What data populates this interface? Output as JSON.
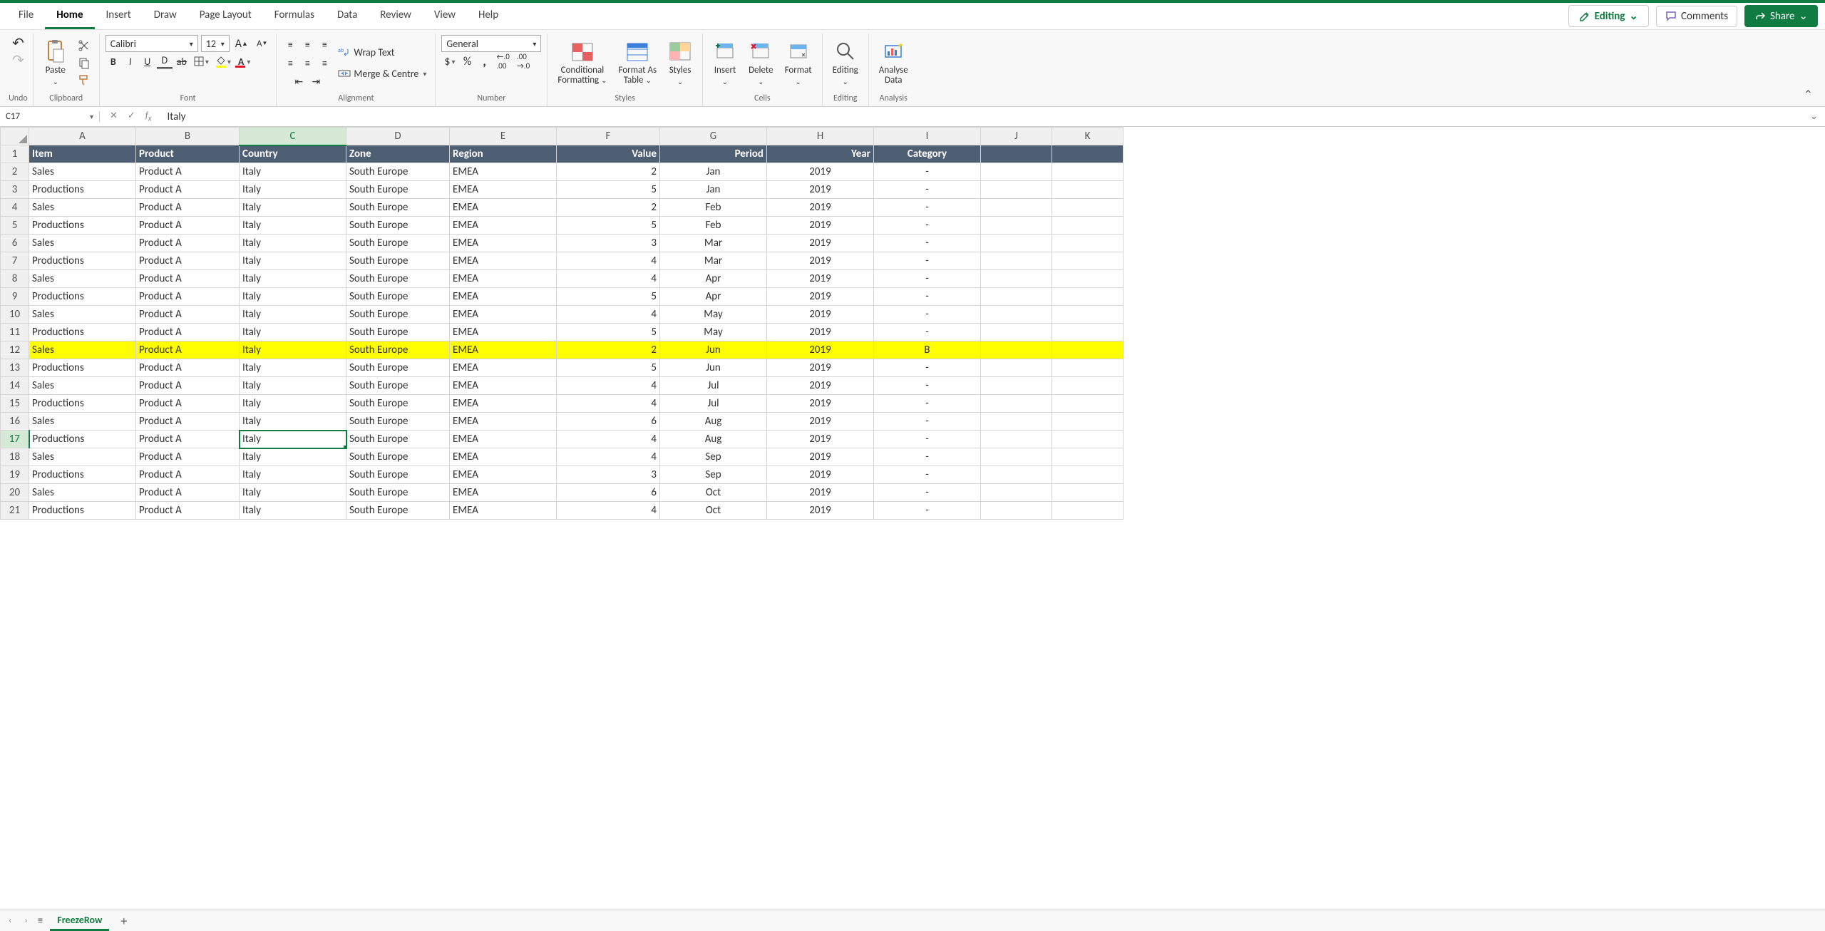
{
  "tabs": [
    "File",
    "Home",
    "Insert",
    "Draw",
    "Page Layout",
    "Formulas",
    "Data",
    "Review",
    "View",
    "Help"
  ],
  "active_tab": "Home",
  "mode_button": "Editing",
  "comments_button": "Comments",
  "share_button": "Share",
  "ribbon": {
    "undo_label": "Undo",
    "clipboard": {
      "paste": "Paste",
      "label": "Clipboard"
    },
    "font": {
      "name": "Calibri",
      "size": "12",
      "label": "Font"
    },
    "alignment": {
      "wrap": "Wrap Text",
      "merge": "Merge & Centre",
      "label": "Alignment"
    },
    "number": {
      "format": "General",
      "label": "Number"
    },
    "styles": {
      "cond": "Conditional Formatting",
      "table": "Format As Table",
      "styles": "Styles",
      "label": "Styles"
    },
    "cells": {
      "insert": "Insert",
      "delete": "Delete",
      "format": "Format",
      "label": "Cells"
    },
    "editing": {
      "label": "Editing",
      "btn": "Editing"
    },
    "analysis": {
      "btn": "Analyse Data",
      "label": "Analysis"
    }
  },
  "name_box": "C17",
  "formula_value": "Italy",
  "columns": [
    "A",
    "B",
    "C",
    "D",
    "E",
    "F",
    "G",
    "H",
    "I",
    "J",
    "K"
  ],
  "col_widths_class": [
    "cA",
    "cB",
    "cC",
    "cD",
    "cE",
    "cF",
    "cG",
    "cH",
    "cI",
    "cJ",
    "cK"
  ],
  "selected_col_idx": 2,
  "selected_row_idx": 17,
  "highlight_row_idx": 12,
  "header_row": [
    "Item",
    "Product",
    "Country",
    "Zone",
    "Region",
    "Value",
    "Period",
    "Year",
    "Category",
    "",
    ""
  ],
  "header_align": [
    "l",
    "l",
    "l",
    "l",
    "l",
    "r",
    "r",
    "r",
    "c",
    "l",
    "l"
  ],
  "rows": [
    [
      "Sales",
      "Product A",
      "Italy",
      "South Europe",
      "EMEA",
      "2",
      "Jan",
      "2019",
      "-",
      "",
      ""
    ],
    [
      "Productions",
      "Product A",
      "Italy",
      "South Europe",
      "EMEA",
      "5",
      "Jan",
      "2019",
      "-",
      "",
      ""
    ],
    [
      "Sales",
      "Product A",
      "Italy",
      "South Europe",
      "EMEA",
      "2",
      "Feb",
      "2019",
      "-",
      "",
      ""
    ],
    [
      "Productions",
      "Product A",
      "Italy",
      "South Europe",
      "EMEA",
      "5",
      "Feb",
      "2019",
      "-",
      "",
      ""
    ],
    [
      "Sales",
      "Product A",
      "Italy",
      "South Europe",
      "EMEA",
      "3",
      "Mar",
      "2019",
      "-",
      "",
      ""
    ],
    [
      "Productions",
      "Product A",
      "Italy",
      "South Europe",
      "EMEA",
      "4",
      "Mar",
      "2019",
      "-",
      "",
      ""
    ],
    [
      "Sales",
      "Product A",
      "Italy",
      "South Europe",
      "EMEA",
      "4",
      "Apr",
      "2019",
      "-",
      "",
      ""
    ],
    [
      "Productions",
      "Product A",
      "Italy",
      "South Europe",
      "EMEA",
      "5",
      "Apr",
      "2019",
      "-",
      "",
      ""
    ],
    [
      "Sales",
      "Product A",
      "Italy",
      "South Europe",
      "EMEA",
      "4",
      "May",
      "2019",
      "-",
      "",
      ""
    ],
    [
      "Productions",
      "Product A",
      "Italy",
      "South Europe",
      "EMEA",
      "5",
      "May",
      "2019",
      "-",
      "",
      ""
    ],
    [
      "Sales",
      "Product A",
      "Italy",
      "South Europe",
      "EMEA",
      "2",
      "Jun",
      "2019",
      "B",
      "",
      ""
    ],
    [
      "Productions",
      "Product A",
      "Italy",
      "South Europe",
      "EMEA",
      "5",
      "Jun",
      "2019",
      "-",
      "",
      ""
    ],
    [
      "Sales",
      "Product A",
      "Italy",
      "South Europe",
      "EMEA",
      "4",
      "Jul",
      "2019",
      "-",
      "",
      ""
    ],
    [
      "Productions",
      "Product A",
      "Italy",
      "South Europe",
      "EMEA",
      "4",
      "Jul",
      "2019",
      "-",
      "",
      ""
    ],
    [
      "Sales",
      "Product A",
      "Italy",
      "South Europe",
      "EMEA",
      "6",
      "Aug",
      "2019",
      "-",
      "",
      ""
    ],
    [
      "Productions",
      "Product A",
      "Italy",
      "South Europe",
      "EMEA",
      "4",
      "Aug",
      "2019",
      "-",
      "",
      ""
    ],
    [
      "Sales",
      "Product A",
      "Italy",
      "South Europe",
      "EMEA",
      "4",
      "Sep",
      "2019",
      "-",
      "",
      ""
    ],
    [
      "Productions",
      "Product A",
      "Italy",
      "South Europe",
      "EMEA",
      "3",
      "Sep",
      "2019",
      "-",
      "",
      ""
    ],
    [
      "Sales",
      "Product A",
      "Italy",
      "South Europe",
      "EMEA",
      "6",
      "Oct",
      "2019",
      "-",
      "",
      ""
    ],
    [
      "Productions",
      "Product A",
      "Italy",
      "South Europe",
      "EMEA",
      "4",
      "Oct",
      "2019",
      "-",
      "",
      ""
    ]
  ],
  "col_align": [
    "l",
    "l",
    "l",
    "l",
    "l",
    "r",
    "c",
    "c",
    "c",
    "l",
    "l"
  ],
  "sheet_name": "FreezeRow"
}
